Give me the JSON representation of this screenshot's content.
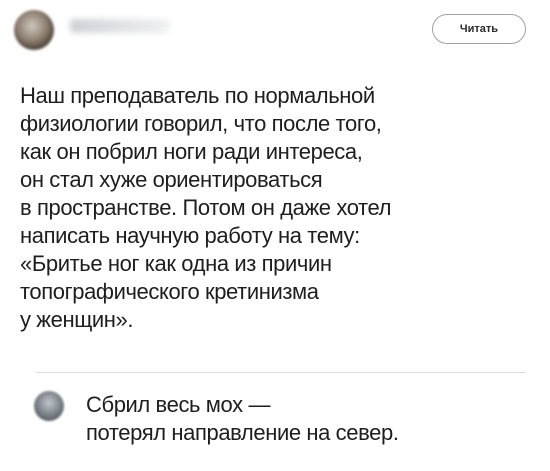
{
  "header": {
    "author_name": "",
    "read_button_label": "Читать"
  },
  "post": {
    "lines": [
      "Наш преподаватель по нормальной",
      "физиологии говорил, что после того,",
      "как он побрил ноги ради интереса,",
      "он стал хуже ориентироваться",
      "в пространстве. Потом он даже хотел",
      "написать научную работу на тему:",
      "«Бритье ног как одна из причин",
      "топографического кретинизма",
      "у женщин»."
    ]
  },
  "reply": {
    "lines": [
      "Сбрил весь мох —",
      "потерял направление на север."
    ]
  },
  "icons": {
    "author_avatar": "avatar-image",
    "reply_avatar": "avatar-image"
  }
}
